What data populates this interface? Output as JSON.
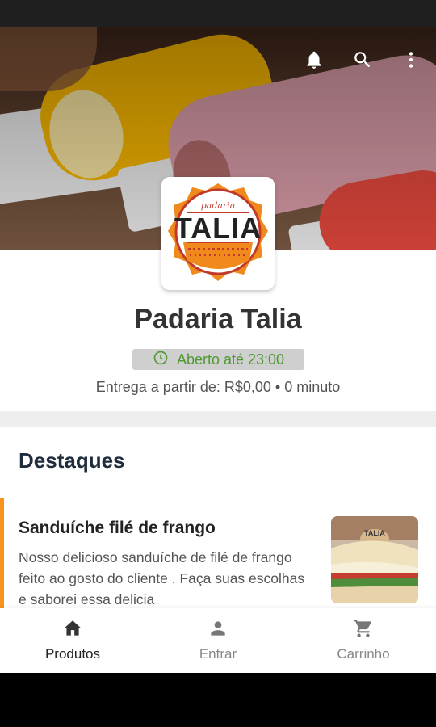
{
  "store": {
    "name": "Padaria Talia",
    "open_status": "Aberto até 23:00",
    "delivery_info": "Entrega a partir de: R$0,00 • 0 minuto",
    "logo": {
      "top_text": "padaria",
      "main_text": "TALIA"
    }
  },
  "header_icons": [
    "bell-icon",
    "search-icon",
    "more-vert-icon"
  ],
  "highlights": {
    "title": "Destaques",
    "products": [
      {
        "name": "Sanduíche filé de frango",
        "description": "Nosso delicioso sanduíche de filé de frango feito ao gosto do cliente . Faça suas escolhas e saborei essa delicia",
        "thumb_label": "TALIA"
      }
    ]
  },
  "bottom_nav": [
    {
      "label": "Produtos",
      "icon": "home-icon",
      "active": true
    },
    {
      "label": "Entrar",
      "icon": "person-icon",
      "active": false
    },
    {
      "label": "Carrinho",
      "icon": "cart-icon",
      "active": false
    }
  ],
  "colors": {
    "accent": "#f7931e",
    "open_text": "#4f9a33",
    "open_bg": "#cfcfcf",
    "title_dark": "#1f2d3d"
  }
}
